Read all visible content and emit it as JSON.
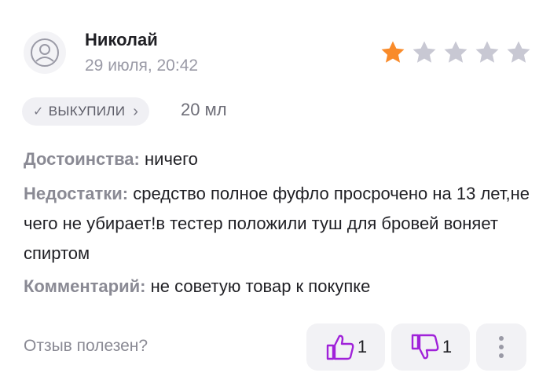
{
  "review": {
    "author": "Николай",
    "date": "29 июля, 20:42",
    "rating": 1,
    "max_rating": 5,
    "badge": "ВЫКУПИЛИ",
    "volume": "20 мл",
    "pros_label": "Достоинства:",
    "pros_text": "ничего",
    "cons_label": "Недостатки:",
    "cons_text": "средство полное фуфло просрочено на 13 лет,не чего не убирает!в тестер положили туш для бровей воняет спиртом",
    "comment_label": "Комментарий:",
    "comment_text": "не советую товар к покупке"
  },
  "footer": {
    "helpful_question": "Отзыв полезен?",
    "likes": "1",
    "dislikes": "1"
  },
  "colors": {
    "star_active": "#f98b2a",
    "star_inactive": "#c8c8d3",
    "accent_purple": "#a022d9"
  }
}
